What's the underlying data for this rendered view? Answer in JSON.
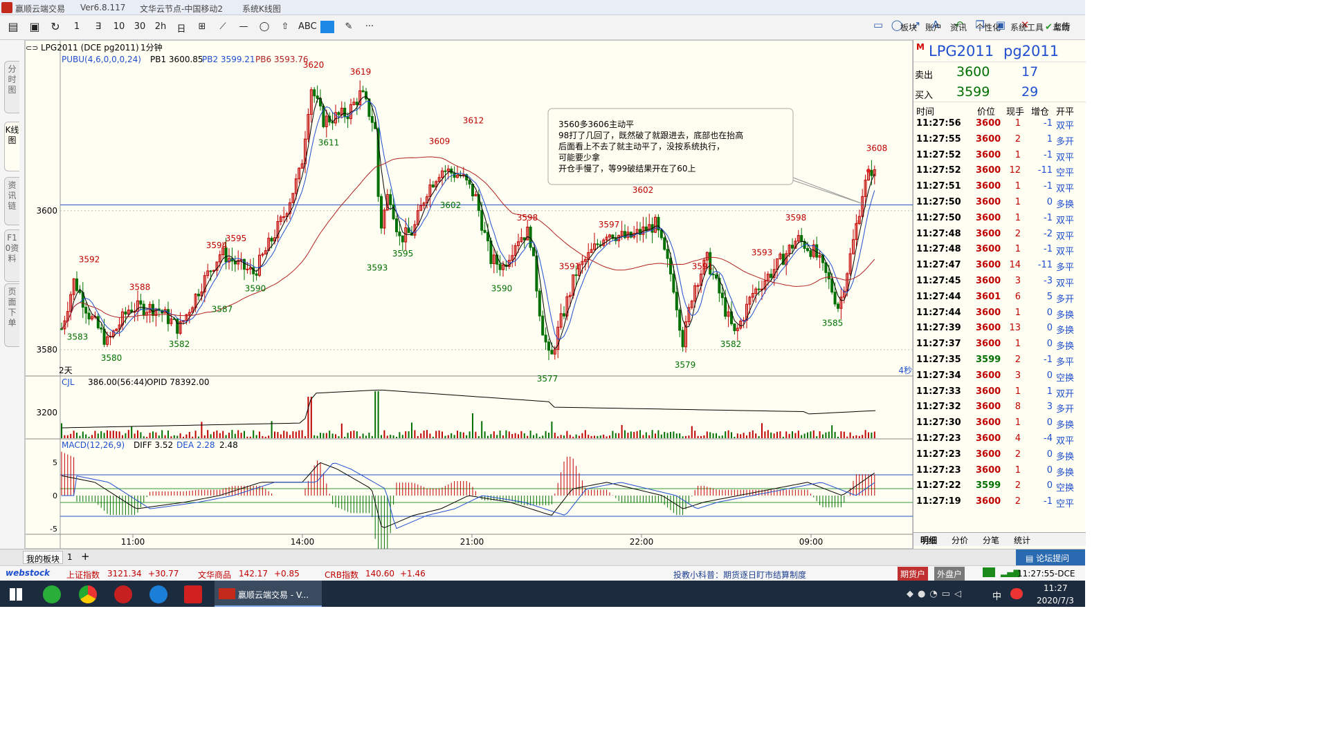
{
  "window": {
    "app_title": "赢顺云端交易",
    "version": "Ver6.8.117",
    "node": "文华云节点-中国移动2",
    "view": "系统K线图"
  },
  "toolbar": {
    "tools": [
      "1",
      "∃",
      "10",
      "30",
      "2h",
      "日",
      "⊞",
      "⟋",
      "—",
      "◯",
      "⇧",
      "ABC",
      "",
      "✎",
      "···"
    ],
    "menus": [
      "板块",
      "账户",
      "资讯",
      "个性化",
      "系统工具",
      "帮助"
    ],
    "upload": "上传"
  },
  "left_tabs": [
    "分时图",
    "K线图",
    "资讯链",
    "F10资料",
    "页面下单"
  ],
  "chart": {
    "symbol_label": "LPG2011 (DCE pg2011)",
    "period": "1分钟",
    "indicator": "PUBU(4,6,0,0,0,24)",
    "pb1": "PB1 3600.85",
    "pb2": "PB2 3599.21",
    "pb6": "PB6 3593.76",
    "y_ticks": [
      "3600",
      "3580"
    ],
    "left_note": "2天",
    "right_note": "4秒",
    "high_labels": [
      "3620",
      "3619",
      "3612",
      "3609",
      "3602",
      "3598",
      "3597",
      "3595",
      "3594",
      "3592",
      "3591",
      "3591",
      "3588",
      "3593",
      "3598",
      "3608"
    ],
    "low_labels": [
      "3611",
      "3602",
      "3595",
      "3593",
      "3590",
      "3590",
      "3587",
      "3583",
      "3582",
      "3580",
      "3577",
      "3579",
      "3582",
      "3585"
    ],
    "annotation": [
      "3560多3606主动平",
      "98打了几回了，既然破了就跟进去，底部也在抬高",
      "后面看上不去了就主动平了，没按系统执行，",
      "可能要少拿",
      "开仓手慢了，等99破结果开在了60上"
    ],
    "vol_indicator": "CJL",
    "vol_value": "386.00(56:44)",
    "opid": "OPID 78392.00",
    "vol_tick": "3200",
    "macd_label": "MACD(12,26,9)",
    "diff": "DIFF 3.52",
    "dea": "DEA 2.28",
    "macd_val": "2.48",
    "macd_ticks": [
      "5",
      "0",
      "-5"
    ],
    "time_labels": [
      "11:00",
      "14:00",
      "21:00",
      "22:00",
      "09:00"
    ]
  },
  "quote": {
    "name": "LPG2011",
    "code": "pg2011",
    "ask_label": "卖出",
    "ask": "3600",
    "ask_vol": "17",
    "bid_label": "买入",
    "bid": "3599",
    "bid_vol": "29",
    "headers": [
      "时间",
      "价位",
      "现手",
      "增仓",
      "开平"
    ],
    "ticks": [
      [
        "11:27:56",
        "3600",
        "1",
        "-1",
        "双平"
      ],
      [
        "11:27:55",
        "3600",
        "2",
        "1",
        "多开"
      ],
      [
        "11:27:52",
        "3600",
        "1",
        "-1",
        "双平"
      ],
      [
        "11:27:52",
        "3600",
        "12",
        "-11",
        "空平"
      ],
      [
        "11:27:51",
        "3600",
        "1",
        "-1",
        "双平"
      ],
      [
        "11:27:50",
        "3600",
        "1",
        "0",
        "多换"
      ],
      [
        "11:27:50",
        "3600",
        "1",
        "-1",
        "双平"
      ],
      [
        "11:27:48",
        "3600",
        "2",
        "-2",
        "双平"
      ],
      [
        "11:27:48",
        "3600",
        "1",
        "-1",
        "双平"
      ],
      [
        "11:27:47",
        "3600",
        "14",
        "-11",
        "多平"
      ],
      [
        "11:27:45",
        "3600",
        "3",
        "-3",
        "双平"
      ],
      [
        "11:27:44",
        "3601",
        "6",
        "5",
        "多开"
      ],
      [
        "11:27:44",
        "3600",
        "1",
        "0",
        "多换"
      ],
      [
        "11:27:39",
        "3600",
        "13",
        "0",
        "多换"
      ],
      [
        "11:27:37",
        "3600",
        "1",
        "0",
        "多换"
      ],
      [
        "11:27:35",
        "3599",
        "2",
        "-1",
        "多平"
      ],
      [
        "11:27:34",
        "3600",
        "3",
        "0",
        "空换"
      ],
      [
        "11:27:33",
        "3600",
        "1",
        "1",
        "双开"
      ],
      [
        "11:27:32",
        "3600",
        "8",
        "3",
        "多开"
      ],
      [
        "11:27:30",
        "3600",
        "1",
        "0",
        "多换"
      ],
      [
        "11:27:23",
        "3600",
        "4",
        "-4",
        "双平"
      ],
      [
        "11:27:23",
        "3600",
        "2",
        "0",
        "多换"
      ],
      [
        "11:27:23",
        "3600",
        "1",
        "0",
        "多换"
      ],
      [
        "11:27:22",
        "3599",
        "2",
        "0",
        "空换"
      ],
      [
        "11:27:19",
        "3600",
        "2",
        "-1",
        "空平"
      ]
    ],
    "tabs": [
      "明细",
      "分价",
      "分笔",
      "统计"
    ],
    "forum": "论坛提问"
  },
  "bottom": {
    "block": "我的板块",
    "block_num": "1",
    "add": "+"
  },
  "ticker": {
    "logo": "webstock",
    "items": [
      "上证指数",
      "3121.34",
      "+30.77",
      "文华商品",
      "142.17",
      "+0.85",
      "CRB指数",
      "140.60",
      "+1.46"
    ],
    "tip": "投教小科普：期货逐日盯市结算制度",
    "futures": "期货户",
    "forex": "外盘户",
    "time": "11:27:55-DCE"
  },
  "taskbar": {
    "app": "赢顺云端交易 - V...",
    "ime": "中",
    "clock": "11:27",
    "date": "2020/7/3"
  },
  "colors": {
    "up": "#c00000",
    "down": "#007000",
    "bg": "#fffef2",
    "ma1": "#000000",
    "ma2": "#1f4fd0",
    "ma3": "#b02020"
  }
}
